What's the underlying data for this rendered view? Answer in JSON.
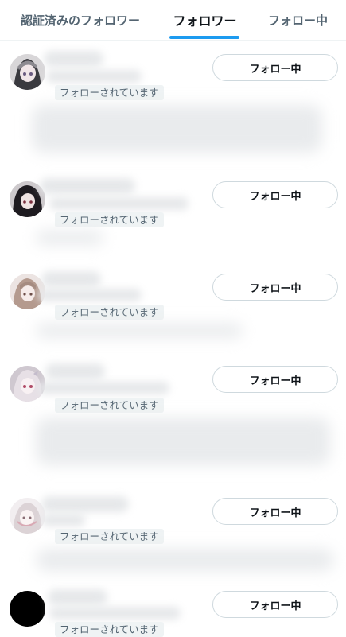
{
  "tabs": [
    {
      "label": "認証済みのフォロワー",
      "active": false
    },
    {
      "label": "フォロワー",
      "active": true
    },
    {
      "label": "フォロー中",
      "active": false
    }
  ],
  "accent_color": "#1d9bf0",
  "rows": [
    {
      "followed_label": "フォローされています",
      "button_label": "フォロー中",
      "avatar": "anime-girl-avatar"
    },
    {
      "followed_label": "フォローされています",
      "button_label": "フォロー中",
      "avatar": "anime-girl-avatar"
    },
    {
      "followed_label": "フォローされています",
      "button_label": "フォロー中",
      "avatar": "anime-girl-avatar"
    },
    {
      "followed_label": "フォローされています",
      "button_label": "フォロー中",
      "avatar": "anime-girl-avatar"
    },
    {
      "followed_label": "フォローされています",
      "button_label": "フォロー中",
      "avatar": "anime-girl-avatar"
    },
    {
      "followed_label": "フォローされています",
      "button_label": "フォロー中",
      "avatar": "black-circle-avatar"
    }
  ]
}
